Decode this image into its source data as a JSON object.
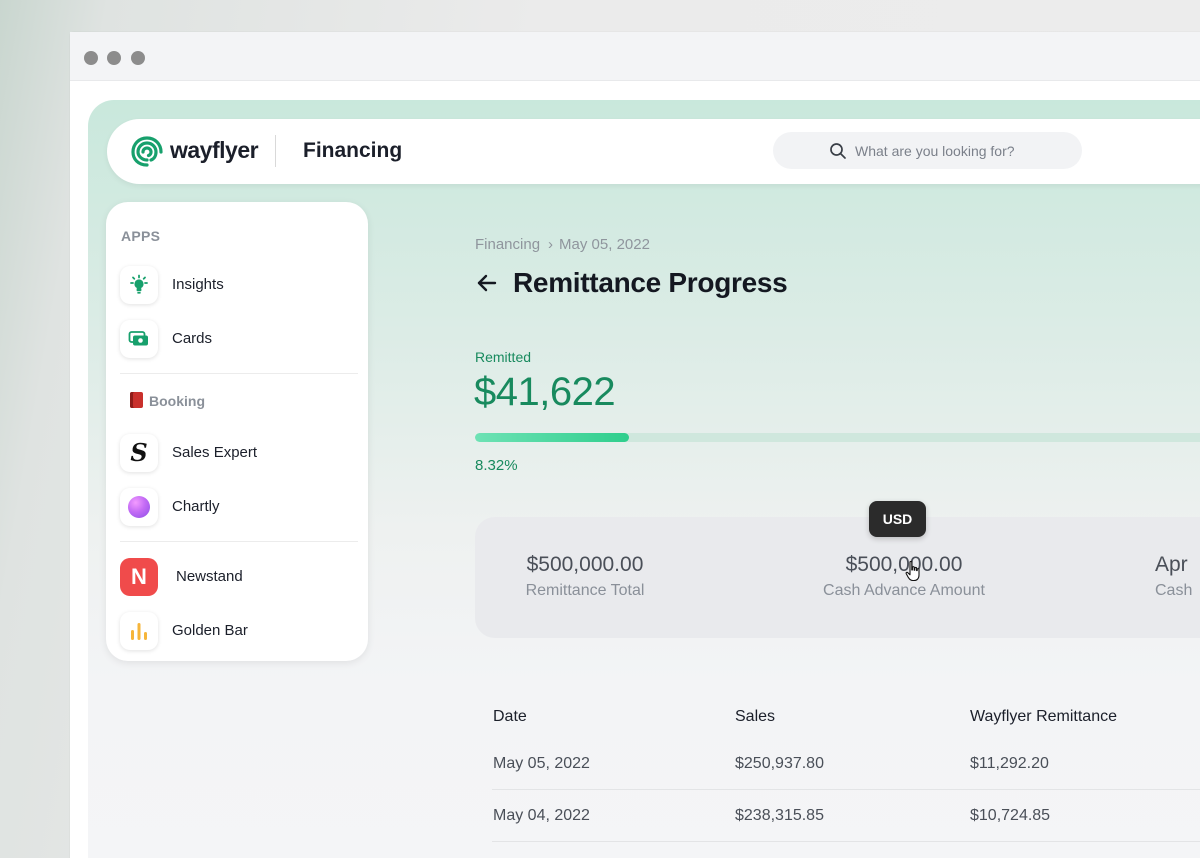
{
  "header": {
    "brand": "wayflyer",
    "section": "Financing",
    "search_placeholder": "What are you looking for?"
  },
  "sidebar": {
    "apps_label": "APPS",
    "items": [
      {
        "label": "Insights",
        "icon": "lightbulb-icon"
      },
      {
        "label": "Cards",
        "icon": "cards-icon"
      },
      {
        "label": "Sales Expert",
        "icon": "sales-expert-logo-icon"
      },
      {
        "label": "Chartly",
        "icon": "chartly-orb-icon"
      },
      {
        "label": "Newstand",
        "icon": "newstand-logo-icon"
      },
      {
        "label": "Golden Bar",
        "icon": "bar-chart-icon"
      }
    ],
    "booking_label": "Booking"
  },
  "breadcrumb": {
    "parent": "Financing",
    "current": "May 05, 2022"
  },
  "page": {
    "title": "Remittance Progress"
  },
  "remitted": {
    "label": "Remitted",
    "amount": "$41,622",
    "percent_text": "8.32%",
    "progress_fraction": 0.0832
  },
  "stats": [
    {
      "value": "$500,000.00",
      "label": "Remittance Total"
    },
    {
      "value": "$500,000.00",
      "label": "Cash Advance Amount"
    },
    {
      "value": "Apr",
      "label": "Cash"
    }
  ],
  "tooltip": "USD",
  "table": {
    "headers": [
      "Date",
      "Sales",
      "Wayflyer Remittance"
    ],
    "rows": [
      [
        "May 05, 2022",
        "$250,937.80",
        "$11,292.20"
      ],
      [
        "May 04, 2022",
        "$238,315.85",
        "$10,724.85"
      ]
    ]
  },
  "colors": {
    "accent": "#188a5e",
    "progress": "#2fce8d",
    "tooltip_bg": "#2b2b2b"
  }
}
